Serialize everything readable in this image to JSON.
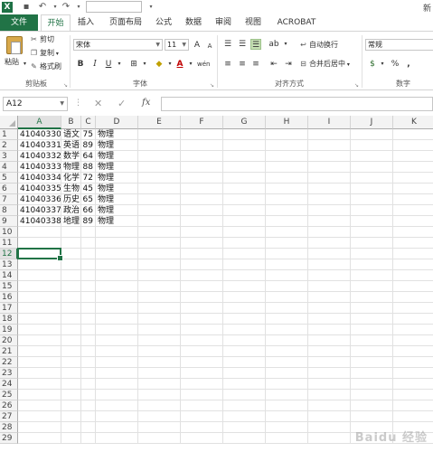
{
  "app": {
    "logo_text": "X",
    "title_fragment": "新"
  },
  "tabs": [
    {
      "label": "文件"
    },
    {
      "label": "开始"
    },
    {
      "label": "插入"
    },
    {
      "label": "页面布局"
    },
    {
      "label": "公式"
    },
    {
      "label": "数据"
    },
    {
      "label": "审阅"
    },
    {
      "label": "视图"
    },
    {
      "label": "ACROBAT"
    }
  ],
  "ribbon": {
    "clipboard": {
      "paste_label": "粘贴",
      "cut_label": "剪切",
      "copy_label": "复制",
      "format_painter_label": "格式刷",
      "group_label": "剪贴板"
    },
    "font": {
      "font_name": "宋体",
      "font_size": "11",
      "group_label": "字体",
      "bold": "B",
      "italic": "I",
      "underline": "U",
      "grow": "A",
      "shrink": "A",
      "font_color": "A",
      "phonetic": "wén"
    },
    "alignment": {
      "wrap_label": "自动换行",
      "merge_label": "合并后居中",
      "group_label": "对齐方式"
    },
    "number": {
      "format": "常规",
      "percent": "%",
      "comma": ",",
      "currency": "$",
      "group_label": "数字"
    }
  },
  "formula_bar": {
    "name_box": "A12",
    "fx_label": "fx",
    "cancel_icon": "✕",
    "enter_icon": "✓",
    "content": ""
  },
  "sheet": {
    "columns": [
      "A",
      "B",
      "C",
      "D",
      "E",
      "F",
      "G",
      "H",
      "I",
      "J",
      "K"
    ],
    "rows": [
      "1",
      "2",
      "3",
      "4",
      "5",
      "6",
      "7",
      "8",
      "9",
      "10",
      "11",
      "12",
      "13",
      "14",
      "15",
      "16",
      "17",
      "18",
      "19",
      "20",
      "21",
      "22",
      "23",
      "24",
      "25",
      "26",
      "27",
      "28",
      "29"
    ],
    "data": [
      [
        "41040330",
        "语文",
        "75",
        "物理"
      ],
      [
        "41040331",
        "英语",
        "89",
        "物理"
      ],
      [
        "41040332",
        "数学",
        "64",
        "物理"
      ],
      [
        "41040333",
        "物理",
        "88",
        "物理"
      ],
      [
        "41040334",
        "化学",
        "72",
        "物理"
      ],
      [
        "41040335",
        "生物",
        "45",
        "物理"
      ],
      [
        "41040336",
        "历史",
        "65",
        "物理"
      ],
      [
        "41040337",
        "政治",
        "66",
        "物理"
      ],
      [
        "41040338",
        "地理",
        "89",
        "物理"
      ]
    ],
    "selected_cell": "A12"
  },
  "watermark": "Baidu 经验"
}
